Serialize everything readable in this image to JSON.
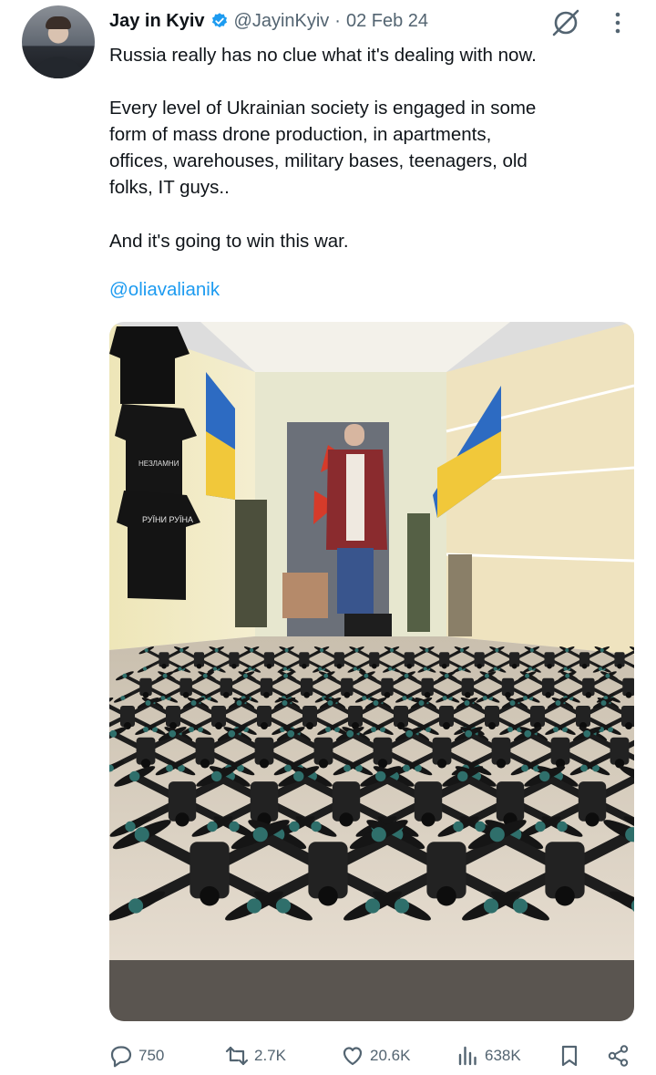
{
  "tweet": {
    "author_name": "Jay in Kyiv",
    "handle": "@JayinKyiv",
    "separator": "·",
    "date": "02 Feb 24",
    "text_line1": "Russia really has no clue what it's dealing with now.",
    "text_para2": "Every level of Ukrainian society is engaged in some\nform of mass drone production, in apartments,\noffices, warehouses, military bases, teenagers, old\nfolks, IT guys..",
    "text_para3": "And it's going to win this war.",
    "mention": "@oliavalianik",
    "shirt_texts": [
      "НЕЗЛАМНИ",
      "РУЇНИ\nРУЇНА"
    ]
  },
  "icons": {
    "avatar": "profile-photo",
    "verified": "verified-badge-icon",
    "grok": "grok-icon",
    "more": "more-vertical-icon",
    "reply": "reply-icon",
    "repost": "repost-icon",
    "like": "heart-icon",
    "views": "views-icon",
    "bookmark": "bookmark-icon",
    "share": "share-icon"
  },
  "stats": {
    "replies": "750",
    "reposts": "2.7K",
    "likes": "20.6K",
    "views": "638K"
  },
  "colors": {
    "text": "#0f1419",
    "secondary": "#536471",
    "link": "#1d9bf0"
  }
}
